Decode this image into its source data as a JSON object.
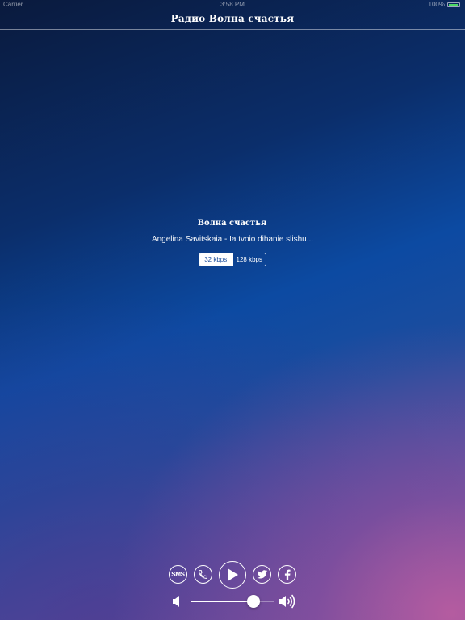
{
  "status_bar": {
    "carrier": "Carrier",
    "time": "3:58 PM",
    "battery": "100%"
  },
  "nav": {
    "title": "Радио Волна счастья"
  },
  "player": {
    "station_name": "Волна счастья",
    "track": "Angelina Savitskaia - Ia tvoio dihanie slishu...",
    "bitrates": [
      {
        "label": "32 kbps",
        "selected": true
      },
      {
        "label": "128 kbps",
        "selected": false
      }
    ],
    "sms_label": "SMS",
    "volume_level": 0.75
  },
  "icons": {
    "sms": "sms-icon",
    "phone": "phone-icon",
    "play": "play-icon",
    "twitter": "twitter-icon",
    "facebook": "facebook-icon",
    "volume_min": "speaker-low-icon",
    "volume_max": "speaker-high-icon"
  }
}
